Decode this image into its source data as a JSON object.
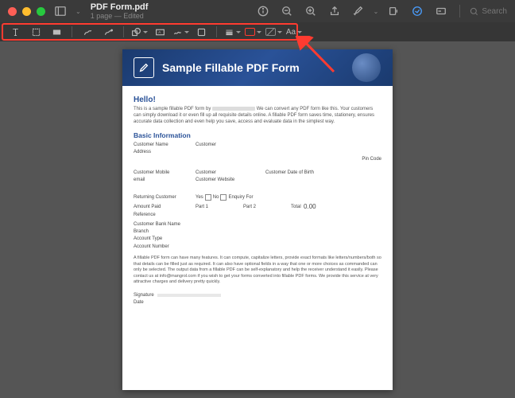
{
  "titlebar": {
    "filename": "PDF Form.pdf",
    "subtitle": "1 page — Edited",
    "search_placeholder": "Search"
  },
  "markup": {
    "font_label": "Aa"
  },
  "doc": {
    "banner_title": "Sample Fillable PDF Form",
    "hello": "Hello!",
    "intro1": "This is a sample fillable PDF form by ",
    "intro2": " We can convert any PDF form like this. Your customers can simply download it or even fill up all requisite details online. A fillable PDF form saves time, stationery, ensures accurate data collection and even help you save, access and evaluate data in the simplest way.",
    "basic_info": "Basic Information",
    "customer_name": "Customer Name",
    "customer": "Customer",
    "address": "Address",
    "pin_code": "Pin Code",
    "customer_mobile": "Customer Mobile",
    "customer_email": "email",
    "customer_website": "Customer Website",
    "customer_dob": "Customer Date of Birth",
    "returning": "Returning Customer",
    "yes": "Yes",
    "no": "No",
    "enquiry": "Enquiry For",
    "amount_paid": "Amount Paid",
    "part1": "Part 1",
    "part2": "Part 2",
    "total": "Total",
    "total_val": "0.00",
    "reference": "Reference",
    "bank_name": "Customer Bank Name",
    "branch": "Branch",
    "account_type": "Account Type",
    "account_number": "Account Number",
    "footer": "A fillable PDF form can have many features. It can compute, capitalize letters, provide exact formats like letters/numbers/both so that details can be filled just as required. It can also have optional fields in a way that one or more choices as commanded can only be selected. The output data from a fillable PDF can be self-explanatory and help the receiver understand it easily. Please contact us at info@mangrol.com if you wish to get your forms converted into fillable PDF forms. We provide this service at very attractive charges and delivery pretty quickly.",
    "signature": "Signature",
    "date": "Date"
  }
}
